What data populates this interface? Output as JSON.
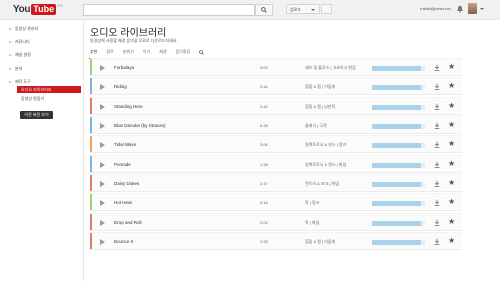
{
  "header": {
    "logo_you": "You",
    "logo_tube": "Tube",
    "logo_region": "KR",
    "upload_label": "업로드",
    "user_email": "ruslist@pixter.net"
  },
  "sidebar": {
    "items": [
      "동영상 관리자",
      "커뮤니티",
      "채널 설정",
      "분석",
      "제작 도구"
    ],
    "active_item": "오디오 라이브러리",
    "sub_item": "동영상 편집기",
    "old_button": "이전 버전 보기"
  },
  "main": {
    "title": "오디오 라이브러리",
    "subtitle": "동영상에 사용할 배경 음악을 무료로 다운로드하세요.",
    "tabs": [
      "추천",
      "장르",
      "분위기",
      "악기",
      "재생",
      "음악종류"
    ],
    "tracks": [
      {
        "name": "Forbalaya",
        "duration": "3:00",
        "genre": "재즈 및 블루스 | 고요하고 밝음",
        "stripe": "#9bd37a",
        "progress": 0.93
      },
      {
        "name": "Riding",
        "duration": "2:44",
        "genre": "힙합 & 랩 | 어둡게",
        "stripe": "#7bb6e0",
        "progress": 0.93
      },
      {
        "name": "Standing Here",
        "duration": "2:42",
        "genre": "힙합 & 랩 | 낭만적",
        "stripe": "#e07b6e",
        "progress": 0.93
      },
      {
        "name": "Blue Danube (by Strauss)",
        "duration": "6:26",
        "genre": "클래식 | 극적",
        "stripe": "#7bb6e0",
        "progress": 0.93
      },
      {
        "name": "Tidal Wave",
        "duration": "3:06",
        "genre": "일렉트로닉 & 댄스 | 펑키",
        "stripe": "#f0a060",
        "progress": 0.93
      },
      {
        "name": "Pomade",
        "duration": "1:38",
        "genre": "일렉트로닉 & 댄스 | 화냄",
        "stripe": "#7bb6e0",
        "progress": 0.93
      },
      {
        "name": "Daisy Dukes",
        "duration": "2:47",
        "genre": "컨트리 & 포크 | 화냄",
        "stripe": "#e07b6e",
        "progress": 0.93
      },
      {
        "name": "Hot Heat",
        "duration": "3:16",
        "genre": "락 | 펑크",
        "stripe": "#9bd37a",
        "progress": 0.93
      },
      {
        "name": "Drop and Roll",
        "duration": "2:02",
        "genre": "락 | 화냄",
        "stripe": "#e07b6e",
        "progress": 0.93
      },
      {
        "name": "Bounce It",
        "duration": "2:33",
        "genre": "힙합 & 랩 | 어둡게",
        "stripe": "#e07b6e",
        "progress": 0.93
      }
    ]
  }
}
